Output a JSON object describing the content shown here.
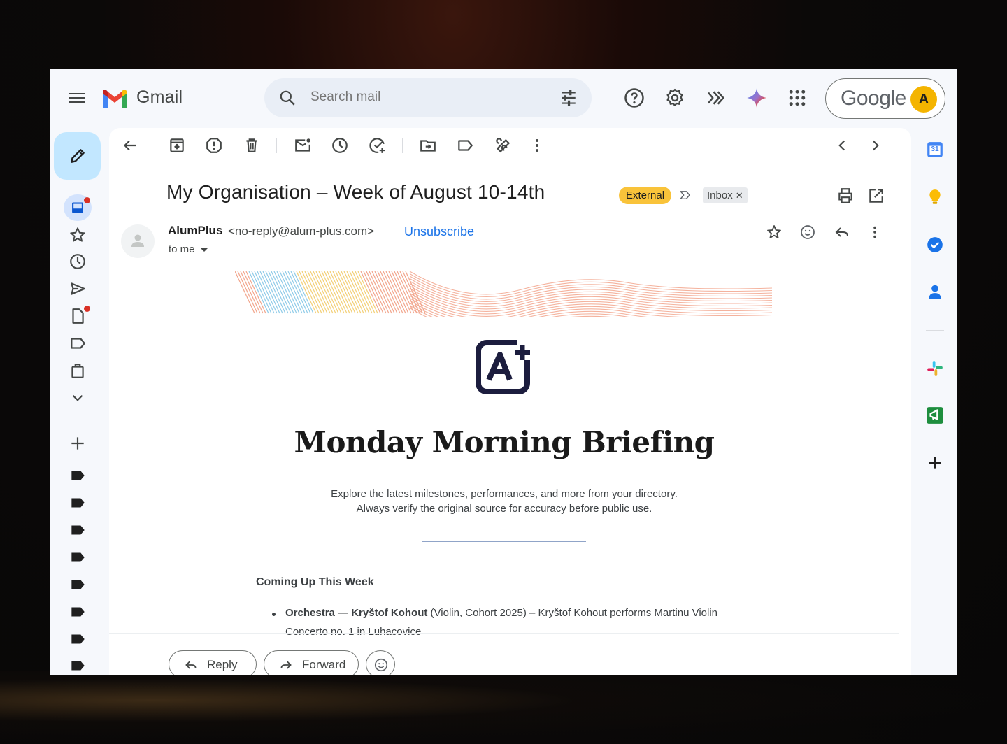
{
  "app": {
    "name": "Gmail"
  },
  "search": {
    "placeholder": "Search mail"
  },
  "account": {
    "brand": "Google",
    "avatar_initial": "A",
    "avatar_color": "#f4b400"
  },
  "email": {
    "subject": "My Organisation –  Week of August 10-14th",
    "labels": {
      "external": "External",
      "inbox": "Inbox"
    },
    "sender": {
      "name": "AlumPlus",
      "email": "<no-reply@alum-plus.com>"
    },
    "unsubscribe": "Unsubscribe",
    "recipient": "to me"
  },
  "newsletter": {
    "title": "Monday Morning Briefing",
    "tagline_1": "Explore the latest milestones, performances, and more from your directory.",
    "tagline_2": "Always verify the original source for accuracy before public use.",
    "section_title": "Coming Up This Week",
    "events": [
      {
        "category": "Orchestra",
        "dash": "—",
        "person": "Kryštof Kohout",
        "details": "(Violin, Cohort 2025) – Kryštof Kohout performs Martinu Violin",
        "details_cont": "Concerto no. 1 in Luhacovice"
      }
    ]
  },
  "actions": {
    "reply": "Reply",
    "forward": "Forward"
  },
  "side_panel": {
    "calendar_day": "31"
  },
  "colors": {
    "accent": "#1a73e8",
    "external_badge": "#f9c33a",
    "compose": "#c2e7ff",
    "unread_dot": "#d93025"
  }
}
